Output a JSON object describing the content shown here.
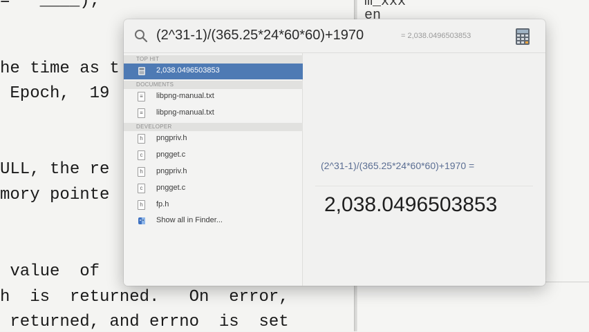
{
  "background": {
    "left_lines": [
      "=   ____);",
      "he time as t",
      " Epoch,  19",
      "ULL, the re",
      "mory pointe",
      " value  of",
      "h  is  returned.   On  error,",
      " returned, and errno  is  set"
    ],
    "right_lines": [
      "m_xxx",
      "en"
    ]
  },
  "spotlight": {
    "query": "(2^31-1)/(365.25*24*60*60)+1970",
    "inline_result": "= 2,038.0496503853",
    "sections": [
      {
        "title": "TOP HIT",
        "items": [
          {
            "label": "2,038.0496503853",
            "icon": "calculator-icon",
            "selected": true
          }
        ]
      },
      {
        "title": "DOCUMENTS",
        "items": [
          {
            "label": "libpng-manual.txt",
            "icon": "text-document-icon",
            "glyph": "≡"
          },
          {
            "label": "libpng-manual.txt",
            "icon": "text-document-icon",
            "glyph": "≡"
          }
        ]
      },
      {
        "title": "DEVELOPER",
        "items": [
          {
            "label": "pngpriv.h",
            "icon": "header-file-icon",
            "glyph": "h"
          },
          {
            "label": "pngget.c",
            "icon": "c-file-icon",
            "glyph": "c"
          },
          {
            "label": "pngpriv.h",
            "icon": "header-file-icon",
            "glyph": "h"
          },
          {
            "label": "pngget.c",
            "icon": "c-file-icon",
            "glyph": "c"
          },
          {
            "label": "fp.h",
            "icon": "header-file-icon",
            "glyph": "h"
          },
          {
            "label": "Show all in Finder...",
            "icon": "finder-icon"
          }
        ]
      }
    ],
    "preview": {
      "expression": "(2^31-1)/(365.25*24*60*60)+1970 =",
      "value": "2,038.0496503853"
    }
  },
  "colors": {
    "selection": "#4e7ab4",
    "expression_text": "#5b6e93"
  }
}
